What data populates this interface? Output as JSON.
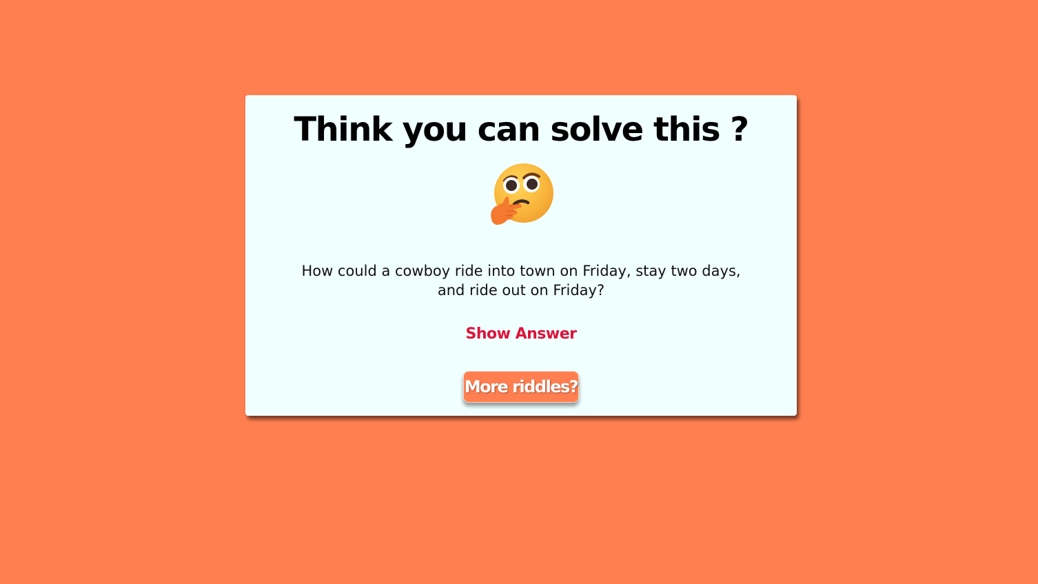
{
  "page": {
    "background_color": "#ff7f50"
  },
  "card": {
    "background_color": "#f0ffff",
    "title": "Think you can solve this ?",
    "emoji_icon": "thinking-face-icon",
    "question": "How could a cowboy ride into town on Friday, stay two days, and ride out on Friday?",
    "show_answer_label": "Show Answer",
    "show_answer_color": "#dc143c",
    "more_button_label": "More riddles?"
  }
}
